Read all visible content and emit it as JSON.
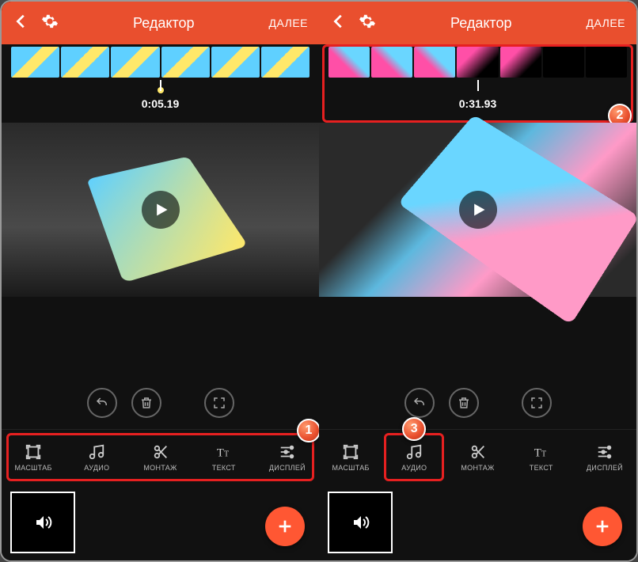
{
  "left": {
    "header": {
      "title": "Редактор",
      "next": "ДАЛЕЕ"
    },
    "timecode": "0:05.19",
    "tools": [
      {
        "id": "scale",
        "label": "МАСШТАБ"
      },
      {
        "id": "audio",
        "label": "АУДИО"
      },
      {
        "id": "montage",
        "label": "МОНТАЖ"
      },
      {
        "id": "text",
        "label": "ТЕКСТ"
      },
      {
        "id": "display",
        "label": "ДИСПЛЕЙ"
      }
    ],
    "callout": "1"
  },
  "right": {
    "header": {
      "title": "Редактор",
      "next": "ДАЛЕЕ"
    },
    "timecode": "0:31.93",
    "tools": [
      {
        "id": "scale",
        "label": "МАСШТАБ"
      },
      {
        "id": "audio",
        "label": "АУДИО"
      },
      {
        "id": "montage",
        "label": "МОНТАЖ"
      },
      {
        "id": "text",
        "label": "ТЕКСТ"
      },
      {
        "id": "display",
        "label": "ДИСПЛЕЙ"
      }
    ],
    "callout_timeline": "2",
    "callout_audio": "3"
  },
  "icons": {
    "back": "chevron-left",
    "settings": "gear",
    "undo": "undo",
    "delete": "trash",
    "fullscreen": "expand",
    "play": "play",
    "volume": "speaker",
    "add": "plus"
  }
}
